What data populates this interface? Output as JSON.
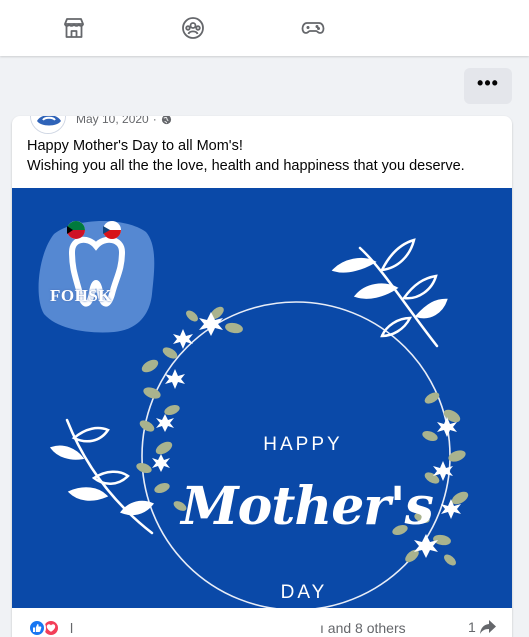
{
  "nav": {
    "items": [
      {
        "name": "marketplace-tab",
        "icon": "storefront-icon"
      },
      {
        "name": "groups-tab",
        "icon": "groups-icon"
      },
      {
        "name": "gaming-tab",
        "icon": "game-controller-icon"
      }
    ]
  },
  "toolbar": {
    "more_label": "•••"
  },
  "post": {
    "date": "May 10, 2020",
    "separator": "·",
    "privacy_icon": "globe-icon",
    "text_line1": "Happy Mother's Day to all Mom's!",
    "text_line2": "Wishing you all the the love, health and happiness that you deserve.",
    "image": {
      "logo_text": "FOHSK",
      "happy": "HAPPY",
      "mothers": "Mother's",
      "day": "DAY",
      "background_color": "#0a49a8"
    }
  },
  "reactions": {
    "icons": [
      "like-icon",
      "love-icon"
    ],
    "partial_name": "l",
    "others_text": "ı and 8 others",
    "share_count": "1"
  },
  "colors": {
    "accent": "#1877f2",
    "love": "#f33e58",
    "secondary_text": "#65676b"
  }
}
